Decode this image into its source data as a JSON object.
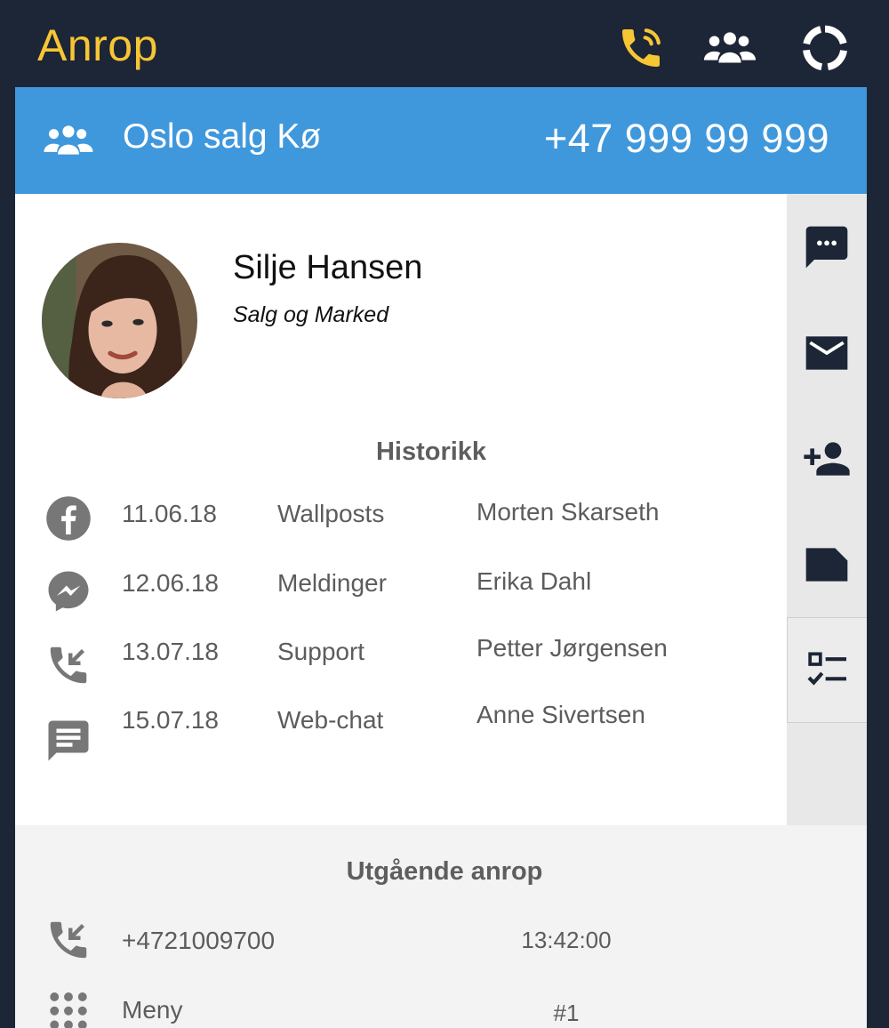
{
  "header": {
    "title": "Anrop",
    "title_color": "#f7c634",
    "background": "#1d2636",
    "icons": [
      "phone-ringing-icon",
      "group-icon",
      "loading-ring-icon"
    ]
  },
  "queue": {
    "icon": "group-icon",
    "name": "Oslo salg Kø",
    "number": "+47 999 99 999",
    "background": "#4098dc"
  },
  "contact": {
    "name": "Silje Hansen",
    "department": "Salg og Marked",
    "avatar": "contact-photo"
  },
  "history": {
    "title": "Historikk",
    "rows": [
      {
        "icon": "facebook-icon",
        "date": "11.06.18",
        "type": "Wallposts",
        "agent": "Morten Skarseth"
      },
      {
        "icon": "messenger-icon",
        "date": "12.06.18",
        "type": "Meldinger",
        "agent": "Erika Dahl"
      },
      {
        "icon": "incoming-call-icon",
        "date": "13.07.18",
        "type": "Support",
        "agent": "Petter Jørgensen"
      },
      {
        "icon": "chat-icon",
        "date": "15.07.18",
        "type": "Web-chat",
        "agent": "Anne Sivertsen"
      }
    ]
  },
  "side_actions": [
    {
      "icon": "sms-icon"
    },
    {
      "icon": "email-icon"
    },
    {
      "icon": "add-contact-icon"
    },
    {
      "icon": "note-icon"
    },
    {
      "icon": "checklist-icon",
      "active": true
    }
  ],
  "outgoing": {
    "title": "Utgående anrop",
    "rows": [
      {
        "icon": "incoming-call-icon",
        "label": "+4721009700",
        "value": "13:42:00"
      },
      {
        "icon": "dialpad-icon",
        "label": "Meny",
        "value": "#1"
      }
    ]
  }
}
